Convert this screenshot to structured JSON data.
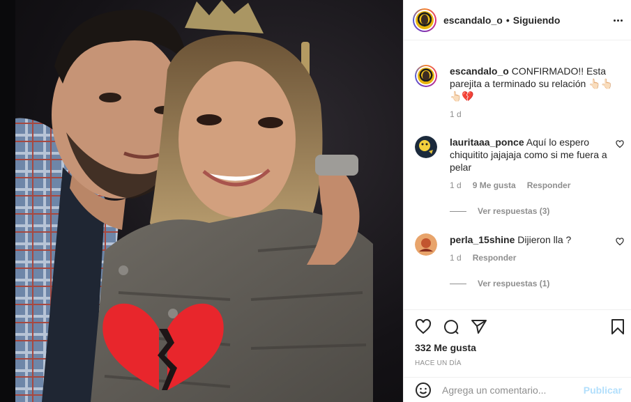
{
  "post": {
    "username": "escandalo_o",
    "follow_status": "Siguiendo",
    "caption_user": "escandalo_o",
    "caption_text": "CONFIRMADO!! Esta parejita a terminado su relación 👆🏻👆🏻👆🏻💔",
    "caption_age": "1 d",
    "likes": "332 Me gusta",
    "posted_ago": "HACE UN DÍA"
  },
  "comments": [
    {
      "user": "lauritaaa_ponce",
      "text": "Aquí lo espero chiquitito jajajaja como si me fuera a pelar",
      "age": "1 d",
      "likes": "9 Me gusta",
      "reply_label": "Responder",
      "view_replies": "Ver respuestas (3)"
    },
    {
      "user": "perla_15shine",
      "text": "Dijieron lla ?",
      "age": "1 d",
      "reply_label": "Responder",
      "view_replies": "Ver respuestas (1)"
    }
  ],
  "add_comment": {
    "placeholder": "Agrega un comentario...",
    "post_label": "Publicar"
  },
  "icons": {
    "like": "heart-icon",
    "comment": "comment-icon",
    "share": "paper-plane-icon",
    "save": "bookmark-icon",
    "emoji": "smiley-icon",
    "more": "ellipsis-icon",
    "sticker": "broken-heart-icon"
  },
  "colors": {
    "post_button_disabled": "#b2dffc",
    "meta_gray": "#8e8e8e",
    "sticker_red": "#e8262c"
  }
}
